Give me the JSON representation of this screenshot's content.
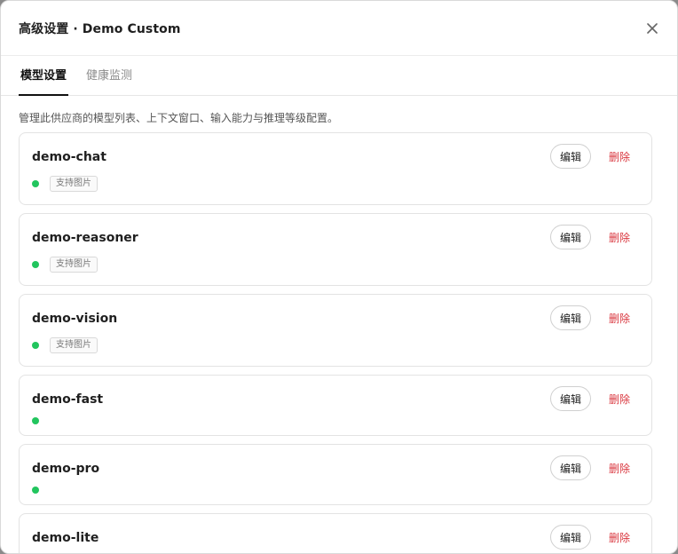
{
  "dialog": {
    "title": "高级设置 · Demo Custom",
    "close_icon": "close-icon"
  },
  "tabs": [
    {
      "label": "模型设置",
      "active": true
    },
    {
      "label": "健康监测",
      "active": false
    }
  ],
  "description": "管理此供应商的模型列表、上下文窗口、输入能力与推理等级配置。",
  "edit_label": "编辑",
  "delete_label": "删除",
  "status_color": "#22c55e",
  "models": [
    {
      "name": "demo-chat",
      "tag": "支持图片"
    },
    {
      "name": "demo-reasoner",
      "tag": "支持图片"
    },
    {
      "name": "demo-vision",
      "tag": "支持图片"
    },
    {
      "name": "demo-fast",
      "tag": ""
    },
    {
      "name": "demo-pro",
      "tag": ""
    },
    {
      "name": "demo-lite",
      "tag": ""
    }
  ]
}
